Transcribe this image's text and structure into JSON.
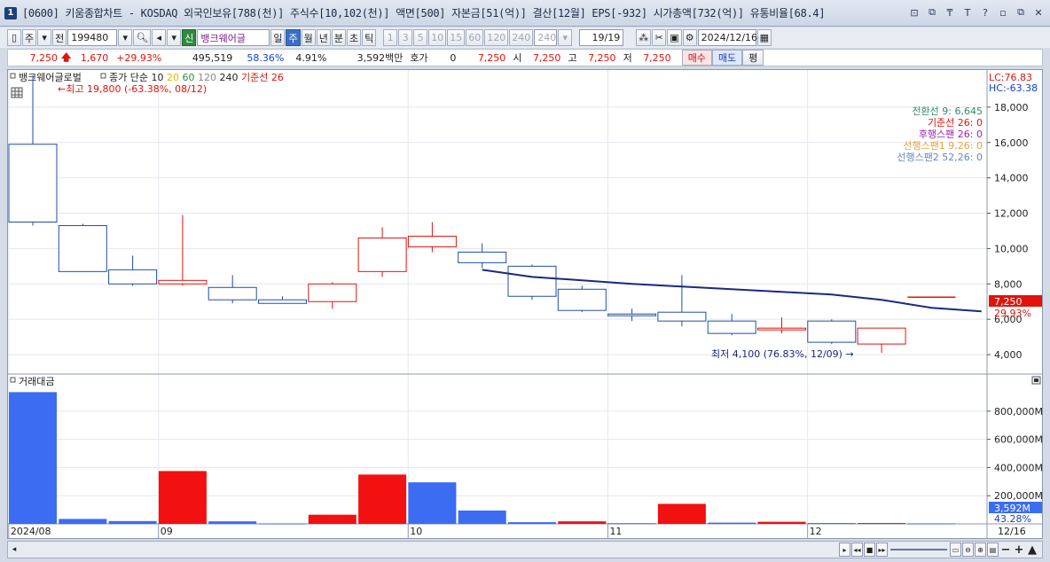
{
  "window": {
    "badge": "1",
    "title": "[0600] 키움종합차트 - KOSDAQ 외국인보유[788(천)] 주식수[10,102(천)] 액면[500] 자본금[51(억)] 결산[12월] EPS[-932] 시가총액[732(억)] 유통비율[68.4]",
    "buttons": [
      "⊡",
      "⧉",
      "₸",
      "T",
      "?",
      "▫",
      "⧉",
      "✕"
    ]
  },
  "toolbar": {
    "period_type": "주",
    "full_label": "전",
    "code": "199480",
    "badge_new": "신",
    "stock_name": "뱅크웨어글",
    "intervals": [
      "일",
      "주",
      "월",
      "년",
      "분",
      "초",
      "틱"
    ],
    "selected_interval": "주",
    "minute_options": [
      "1",
      "3",
      "5",
      "10",
      "15",
      "60",
      "120",
      "240"
    ],
    "minute_value": "240",
    "count": "19/19",
    "date": "2024/12/16"
  },
  "quote": {
    "price": "7,250",
    "change": "1,670",
    "change_pct": "+29.93%",
    "volume": "495,519",
    "volume_ratio": "58.36%",
    "turnover": "4.91%",
    "amount": "3,592백만",
    "quote_label": "호가",
    "quote_value": "0",
    "quote_price": "7,250",
    "open_label": "시",
    "open": "7,250",
    "high_label": "고",
    "high": "7,250",
    "low_label": "저",
    "low": "7,250",
    "buy_label": "매수",
    "sell_label": "매도",
    "flat_label": "평"
  },
  "price_panel": {
    "legend_name": "뱅크웨어글로벌",
    "legend_items": [
      {
        "text": "종가 단순",
        "color": "#222222"
      },
      {
        "text": "10",
        "color": "#222222"
      },
      {
        "text": "20",
        "color": "#e6b800"
      },
      {
        "text": "60",
        "color": "#2e8a3e"
      },
      {
        "text": "120",
        "color": "#888888"
      },
      {
        "text": "240",
        "color": "#222222"
      },
      {
        "text": "기준선 26",
        "color": "#e0140c"
      }
    ],
    "high_note": "←최고 19,800 (-63.38%, 08/12)",
    "low_note": "최저 4,100 (76.83%, 12/09) →",
    "lc": "LC:76.83",
    "hc": "HC:-63.38",
    "ichimoku": [
      {
        "text": "전환선 9: 6,645",
        "color": "#2e8a6a"
      },
      {
        "text": "기준선 26: 0",
        "color": "#e0140c"
      },
      {
        "text": "후행스팬 26: 0",
        "color": "#9a1fb0"
      },
      {
        "text": "선행스팬1 9,26: 0",
        "color": "#e6a23c"
      },
      {
        "text": "선행스팬2 52,26: 0",
        "color": "#5f86c8"
      }
    ],
    "current_label": "7,250",
    "current_pct": "29.93%"
  },
  "volume_panel": {
    "title": "거래대금",
    "current_label": "3,592M",
    "current_pct": "43.28%"
  },
  "chart_data": {
    "type": "candlestick",
    "price_axis": {
      "ylim": [
        2900,
        20100
      ],
      "ticks": [
        4000,
        6000,
        8000,
        10000,
        12000,
        14000,
        16000,
        18000
      ],
      "tick_labels": [
        "4,000",
        "6,000",
        "8,000",
        "10,000",
        "12,000",
        "14,000",
        "16,000",
        "18,000"
      ]
    },
    "volume_axis": {
      "ylim": [
        0,
        950
      ],
      "ticks": [
        200,
        400,
        600,
        800
      ],
      "tick_labels": [
        "200,000M",
        "400,000M",
        "600,000M",
        "800,000M"
      ]
    },
    "x_labels": [
      {
        "index": 0,
        "text": "2024/08"
      },
      {
        "index": 3,
        "text": "09"
      },
      {
        "index": 8,
        "text": "10"
      },
      {
        "index": 12,
        "text": "11"
      },
      {
        "index": 16,
        "text": "12"
      }
    ],
    "current_date_label": "12/16",
    "candles": [
      {
        "o": 15900,
        "h": 19800,
        "l": 11300,
        "c": 11500
      },
      {
        "o": 11300,
        "h": 11400,
        "l": 8700,
        "c": 8700
      },
      {
        "o": 8800,
        "h": 9600,
        "l": 7900,
        "c": 8000
      },
      {
        "o": 8000,
        "h": 11900,
        "l": 7900,
        "c": 8200
      },
      {
        "o": 7800,
        "h": 8500,
        "l": 6900,
        "c": 7100
      },
      {
        "o": 7100,
        "h": 7300,
        "l": 6900,
        "c": 6900
      },
      {
        "o": 7000,
        "h": 8100,
        "l": 6600,
        "c": 8000
      },
      {
        "o": 8700,
        "h": 11200,
        "l": 8400,
        "c": 10600
      },
      {
        "o": 10100,
        "h": 11500,
        "l": 9800,
        "c": 10700
      },
      {
        "o": 9800,
        "h": 10300,
        "l": 8900,
        "c": 9200
      },
      {
        "o": 9000,
        "h": 9100,
        "l": 7100,
        "c": 7300
      },
      {
        "o": 7700,
        "h": 7900,
        "l": 6400,
        "c": 6500
      },
      {
        "o": 6300,
        "h": 6600,
        "l": 5900,
        "c": 6200
      },
      {
        "o": 6400,
        "h": 8500,
        "l": 5600,
        "c": 5900
      },
      {
        "o": 5900,
        "h": 6300,
        "l": 5100,
        "c": 5200
      },
      {
        "o": 5400,
        "h": 6100,
        "l": 5200,
        "c": 5500
      },
      {
        "o": 5900,
        "h": 6000,
        "l": 4600,
        "c": 4700
      },
      {
        "o": 4600,
        "h": 5500,
        "l": 4100,
        "c": 5500
      },
      {
        "o": 7250,
        "h": 7250,
        "l": 7250,
        "c": 7250
      }
    ],
    "ma_line": {
      "start_index": 9,
      "values": [
        8800,
        8400,
        8200,
        8000,
        7850,
        7700,
        7550,
        7400,
        7100,
        6650,
        6450
      ]
    },
    "volume": [
      {
        "v": 935,
        "up": false
      },
      {
        "v": 35,
        "up": false
      },
      {
        "v": 20,
        "up": false
      },
      {
        "v": 375,
        "up": true
      },
      {
        "v": 18,
        "up": false
      },
      {
        "v": 3,
        "up": false
      },
      {
        "v": 65,
        "up": true
      },
      {
        "v": 350,
        "up": true
      },
      {
        "v": 295,
        "up": false
      },
      {
        "v": 95,
        "up": false
      },
      {
        "v": 12,
        "up": false
      },
      {
        "v": 18,
        "up": true
      },
      {
        "v": 5,
        "up": false
      },
      {
        "v": 142,
        "up": true
      },
      {
        "v": 9,
        "up": false
      },
      {
        "v": 15,
        "up": true
      },
      {
        "v": 6,
        "up": false
      },
      {
        "v": 6,
        "up": true
      },
      {
        "v": 3.6,
        "up": false
      }
    ],
    "colors": {
      "up": "#e0140c",
      "down": "#1f4ea8",
      "down_fill": "#ffffff",
      "ma": "#1a2880",
      "vol_up": "#f21010",
      "vol_down": "#3b6cf2"
    }
  }
}
